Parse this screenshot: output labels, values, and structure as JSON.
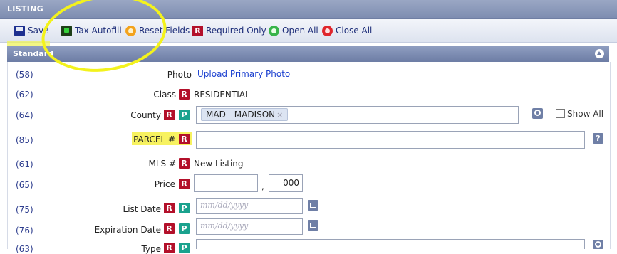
{
  "window": {
    "title": "LISTING"
  },
  "toolbar": {
    "save": "Save",
    "tax_autofill": "Tax Autofill",
    "reset_fields": "Reset Fields",
    "required_only": "Required Only",
    "open_all": "Open All",
    "close_all": "Close All",
    "required_glyph": "R"
  },
  "section": {
    "title": "Standard"
  },
  "badges": {
    "r": "R",
    "p": "P"
  },
  "fields": {
    "photo": {
      "num": "(58)",
      "label": "Photo",
      "link": "Upload Primary Photo"
    },
    "class": {
      "num": "(62)",
      "label": "Class",
      "value": "RESIDENTIAL"
    },
    "county": {
      "num": "(64)",
      "label": "County",
      "tag": "MAD - MADISON",
      "tag_remove": "×",
      "show_all": "Show All"
    },
    "parcel": {
      "num": "(85)",
      "label": "PARCEL #",
      "value": "",
      "help": "?"
    },
    "mls": {
      "num": "(61)",
      "label": "MLS #",
      "value": "New Listing"
    },
    "price": {
      "num": "(65)",
      "label": "Price",
      "value": "",
      "separator": ",",
      "suffix": "000"
    },
    "list_date": {
      "num": "(75)",
      "label": "List Date",
      "placeholder": "mm/dd/yyyy"
    },
    "expiration_date": {
      "num": "(76)",
      "label": "Expiration Date",
      "placeholder": "mm/dd/yyyy"
    },
    "type": {
      "num": "(63)",
      "label": "Type",
      "value": ""
    }
  },
  "colors": {
    "required": "#b3102a",
    "public": "#1aa28e",
    "highlight": "#f7f260",
    "link": "#1a3fcf"
  }
}
